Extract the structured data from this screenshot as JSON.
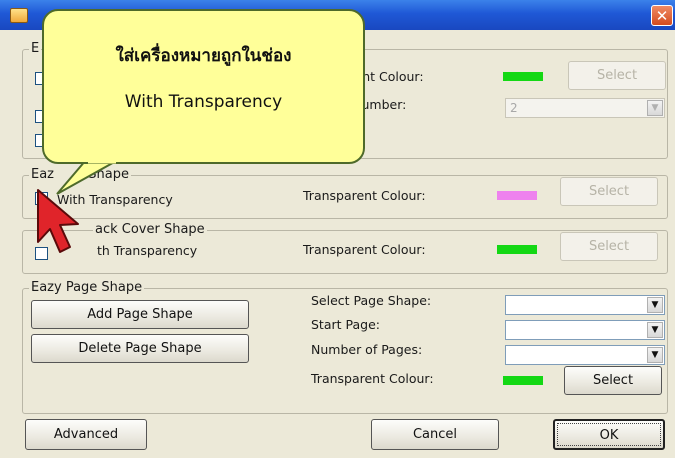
{
  "titlebar": {
    "close_label": "✕"
  },
  "group_top": {
    "legend": "E",
    "transparent_colour_label": "arent Colour:",
    "transparent_colour": "#14d814",
    "select_label": "Select",
    "number_label": "lumber:",
    "number_value": "2"
  },
  "group_front": {
    "legend": "Eazy Front Shape",
    "legend_visible": "Eaz      r Shape",
    "checkbox_label": "With Transparency",
    "transparent_colour_label": "Transparent Colour:",
    "transparent_colour": "#ee82ee",
    "select_label": "Select"
  },
  "group_back": {
    "legend_visible": "ack Cover Shape",
    "checkbox_label": "th Transparency",
    "transparent_colour_label": "Transparent Colour:",
    "transparent_colour": "#14d814",
    "select_label": "Select"
  },
  "group_page": {
    "legend": "Eazy Page Shape",
    "add_label": "Add Page Shape",
    "delete_label": "Delete Page Shape",
    "select_page_shape_label": "Select Page Shape:",
    "start_page_label": "Start Page:",
    "number_of_pages_label": "Number of Pages:",
    "transparent_colour_label": "Transparent Colour:",
    "transparent_colour": "#14d814",
    "select_label": "Select"
  },
  "footer": {
    "advanced_label": "Advanced",
    "cancel_label": "Cancel",
    "ok_label": "OK"
  },
  "callout": {
    "line1": "ใส่เครื่องหมายถูกในช่อง",
    "line2": "With Transparency",
    "fill": "#ffff99"
  },
  "icons": [
    "app-icon",
    "close-icon",
    "dropdown-arrow-icon",
    "mouse-cursor-icon"
  ]
}
